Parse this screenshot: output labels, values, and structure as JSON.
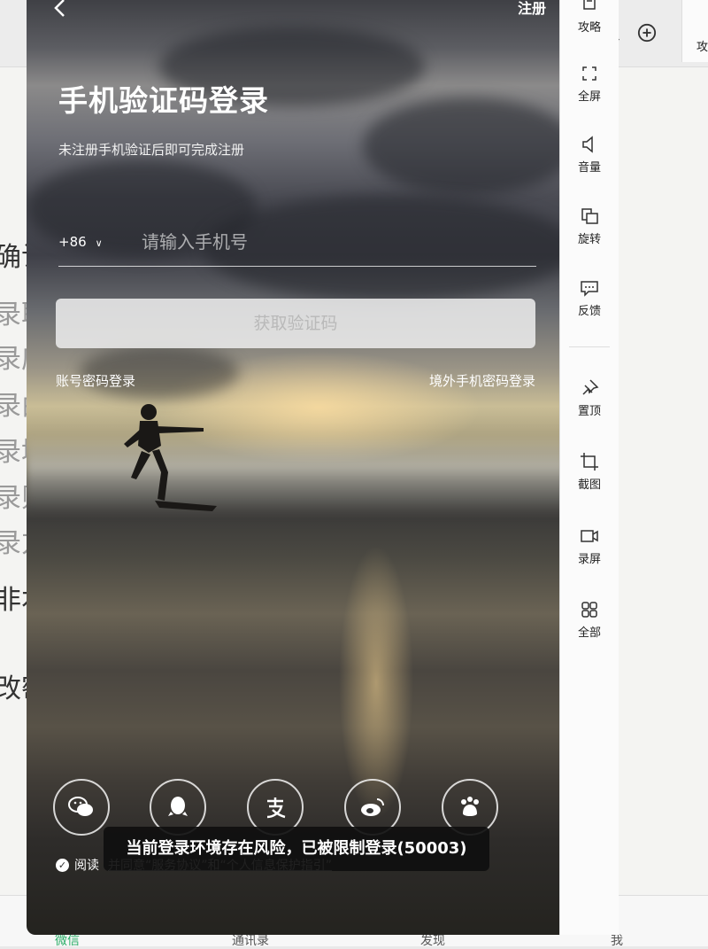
{
  "background_app": {
    "top_icons": [
      "search-icon",
      "plus-circle-icon"
    ],
    "left_text": [
      "确认",
      "录取",
      "录应",
      "录由",
      "录域",
      "录则",
      "录方",
      "非本",
      "改密"
    ],
    "bottom_tabs": [
      "微信",
      "通讯录",
      "发现",
      "我"
    ]
  },
  "phone": {
    "back_icon": "chevron-left-icon",
    "register_label": "注册",
    "title": "手机验证码登录",
    "subtitle": "未注册手机验证后即可完成注册",
    "country_code": "+86",
    "phone_placeholder": "请输入手机号",
    "get_code_label": "获取验证码",
    "link_password_login": "账号密码登录",
    "link_overseas_login": "境外手机密码登录",
    "social_logins": [
      "wechat-icon",
      "qq-icon",
      "alipay-icon",
      "weibo-icon",
      "baidu-icon"
    ],
    "agreement_prefix": "阅读",
    "agreement_links": "并同意“服务协议”和“个人信息保护指引”",
    "toast": "当前登录环境存在风险，已被限制登录(50003)"
  },
  "toolbar": {
    "items": [
      {
        "label": "攻略",
        "icon": "guide-icon"
      },
      {
        "label": "全屏",
        "icon": "fullscreen-icon"
      },
      {
        "label": "音量",
        "icon": "volume-icon"
      },
      {
        "label": "旋转",
        "icon": "rotate-icon"
      },
      {
        "label": "反馈",
        "icon": "feedback-icon"
      },
      {
        "label": "置顶",
        "icon": "pin-icon"
      },
      {
        "label": "截图",
        "icon": "crop-icon"
      },
      {
        "label": "录屏",
        "icon": "record-icon"
      },
      {
        "label": "全部",
        "icon": "grid-icon"
      }
    ],
    "cut_off_label": "攻"
  }
}
